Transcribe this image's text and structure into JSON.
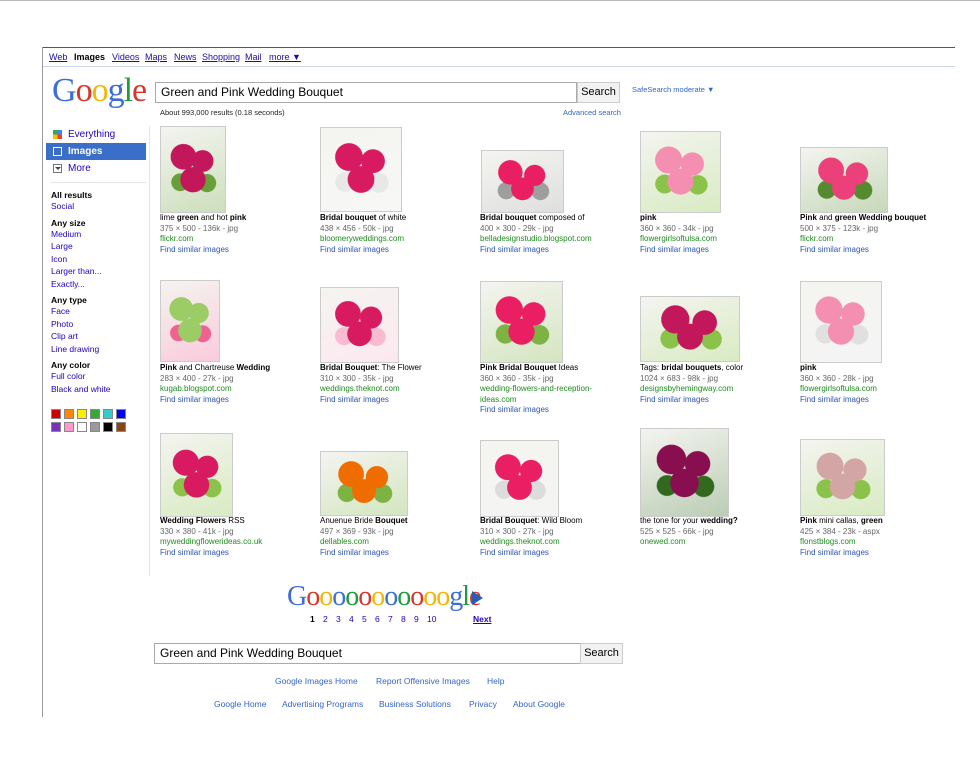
{
  "topnav": [
    {
      "label": "Web",
      "active": false
    },
    {
      "label": "Images",
      "active": true
    },
    {
      "label": "Videos",
      "active": false
    },
    {
      "label": "Maps",
      "active": false
    },
    {
      "label": "News",
      "active": false
    },
    {
      "label": "Shopping",
      "active": false
    },
    {
      "label": "Mail",
      "active": false
    },
    {
      "label": "more ▼",
      "active": false
    }
  ],
  "logo": "Google",
  "search": {
    "query": "Green and Pink Wedding Bouquet",
    "button_label": "Search",
    "safesearch": "SafeSearch moderate ▼",
    "advanced": "Advanced search",
    "results_count": "About 993,000 results (0.18 seconds)"
  },
  "sidebar": {
    "nav": [
      {
        "label": "Everything",
        "icon": "everything-icon"
      },
      {
        "label": "Images",
        "icon": "images-icon",
        "active": true
      },
      {
        "label": "More",
        "icon": "more-icon"
      }
    ],
    "groups": [
      {
        "title": "All results",
        "items": [
          "Social"
        ]
      },
      {
        "title": "Any size",
        "items": [
          "Medium",
          "Large",
          "Icon",
          "Larger than...",
          "Exactly..."
        ]
      },
      {
        "title": "Any type",
        "items": [
          "Face",
          "Photo",
          "Clip art",
          "Line drawing"
        ]
      },
      {
        "title": "Any color",
        "items": [
          "Full color",
          "Black and white"
        ]
      }
    ],
    "swatches": [
      "#cc0000",
      "#ff8800",
      "#ffee00",
      "#33aa33",
      "#33cccc",
      "#0000ee",
      "#7733bb",
      "#ff99cc",
      "#ffffff",
      "#999999",
      "#000000",
      "#8b4513"
    ]
  },
  "results": [
    {
      "title": [
        {
          "t": "lime "
        },
        {
          "t": "green",
          "b": true
        },
        {
          "t": " and hot "
        },
        {
          "t": "pink",
          "b": true
        }
      ],
      "meta": "375 × 500 - 136k - jpg",
      "site": "flickr.com",
      "similar": "Find similar images",
      "colors": [
        "#c2185b",
        "#689f38"
      ]
    },
    {
      "title": [
        {
          "t": "Bridal bouquet",
          "b": true
        },
        {
          "t": " of white"
        }
      ],
      "meta": "438 × 456 - 50k - jpg",
      "site": "bloomeryweddings.com",
      "similar": "Find similar images",
      "colors": [
        "#d81b60",
        "#e8e8e8"
      ]
    },
    {
      "title": [
        {
          "t": "Bridal bouquet",
          "b": true
        },
        {
          "t": " composed of"
        }
      ],
      "meta": "400 × 300 - 29k - jpg",
      "site": "belladesignstudio.blogspot.com",
      "similar": "Find similar images",
      "colors": [
        "#e91e63",
        "#9e9e9e"
      ]
    },
    {
      "title": [
        {
          "t": "pink",
          "b": true
        }
      ],
      "meta": "360 × 360 - 34k - jpg",
      "site": "flowergirlsoftulsa.com",
      "similar": "Find similar images",
      "colors": [
        "#f48fb1",
        "#8bc34a"
      ]
    },
    {
      "title": [
        {
          "t": "Pink",
          "b": true
        },
        {
          "t": " and "
        },
        {
          "t": "green Wedding bouquet",
          "b": true
        }
      ],
      "meta": "500 × 375 - 123k - jpg",
      "site": "flickr.com",
      "similar": "Find similar images",
      "colors": [
        "#ec407a",
        "#558b2f"
      ]
    },
    {
      "title": [
        {
          "t": "Pink",
          "b": true
        },
        {
          "t": " and Chartreuse "
        },
        {
          "t": "Wedding",
          "b": true
        }
      ],
      "meta": "283 × 400 - 27k - jpg",
      "site": "kugab.blogspot.com",
      "similar": "Find similar images",
      "colors": [
        "#9ccc65",
        "#f06292"
      ]
    },
    {
      "title": [
        {
          "t": "Bridal Bouquet",
          "b": true
        },
        {
          "t": ": The Flower"
        }
      ],
      "meta": "310 × 300 - 35k - jpg",
      "site": "weddings.theknot.com",
      "similar": "Find similar images",
      "colors": [
        "#d81b60",
        "#f8bbd0"
      ]
    },
    {
      "title": [
        {
          "t": "Pink Bridal Bouquet",
          "b": true
        },
        {
          "t": " Ideas"
        }
      ],
      "meta": "360 × 360 - 35k - jpg",
      "site": "wedding-flowers-and-reception-ideas.com",
      "similar": "Find similar images",
      "colors": [
        "#e91e63",
        "#7cb342"
      ]
    },
    {
      "title": [
        {
          "t": "Tags: "
        },
        {
          "t": "bridal bouquets",
          "b": true
        },
        {
          "t": ", color"
        }
      ],
      "meta": "1024 × 683 - 98k - jpg",
      "site": "designsbyhemingway.com",
      "similar": "Find similar images",
      "colors": [
        "#c2185b",
        "#8bc34a"
      ]
    },
    {
      "title": [
        {
          "t": "pink",
          "b": true
        }
      ],
      "meta": "360 × 360 - 28k - jpg",
      "site": "flowergirlsoftulsa.com",
      "similar": "Find similar images",
      "colors": [
        "#f48fb1",
        "#e0e0e0"
      ]
    },
    {
      "title": [
        {
          "t": "Wedding Flowers",
          "b": true
        },
        {
          "t": " RSS"
        }
      ],
      "meta": "330 × 380 - 41k - jpg",
      "site": "myweddingflowerideas.co.uk",
      "similar": "Find similar images",
      "colors": [
        "#d81b60",
        "#8bc34a"
      ]
    },
    {
      "title": [
        {
          "t": "Anuenue Bride "
        },
        {
          "t": "Bouquet",
          "b": true
        }
      ],
      "meta": "497 × 369 - 93k - jpg",
      "site": "dellables.com",
      "similar": "Find similar images",
      "colors": [
        "#ef6c00",
        "#7cb342"
      ]
    },
    {
      "title": [
        {
          "t": "Bridal Bouquet",
          "b": true
        },
        {
          "t": ": Wild Bloom"
        }
      ],
      "meta": "310 × 300 - 27k - jpg",
      "site": "weddings.theknot.com",
      "similar": "Find similar images",
      "colors": [
        "#e91e63",
        "#dcdcdc"
      ]
    },
    {
      "title": [
        {
          "t": "the tone for your "
        },
        {
          "t": "wedding?",
          "b": true
        }
      ],
      "meta": "525 × 525 - 66k - jpg",
      "site": "onewed.com",
      "similar": "",
      "colors": [
        "#880e4f",
        "#33691e"
      ]
    },
    {
      "title": [
        {
          "t": "Pink",
          "b": true
        },
        {
          "t": " mini callas, "
        },
        {
          "t": "green",
          "b": true
        }
      ],
      "meta": "425 × 384 - 23k - aspx",
      "site": "flonstblogs.com",
      "similar": "Find similar images",
      "colors": [
        "#d4a5a5",
        "#8bc34a"
      ]
    }
  ],
  "pagination": {
    "logo_letters": [
      "G",
      "o",
      "o",
      "o",
      "o",
      "o",
      "o",
      "o",
      "o",
      "o",
      "o",
      "o",
      "g",
      "l",
      "e"
    ],
    "pages": [
      "1",
      "2",
      "3",
      "4",
      "5",
      "6",
      "7",
      "8",
      "9",
      "10"
    ],
    "next": "Next"
  },
  "bottom_search": {
    "query": "Green and Pink Wedding Bouquet",
    "button_label": "Search"
  },
  "footer": {
    "row1": [
      "Google Images Home",
      "Report Offensive Images",
      "Help"
    ],
    "row2": [
      "Google Home",
      "Advertising Programs",
      "Business Solutions",
      "Privacy",
      "About Google"
    ]
  }
}
